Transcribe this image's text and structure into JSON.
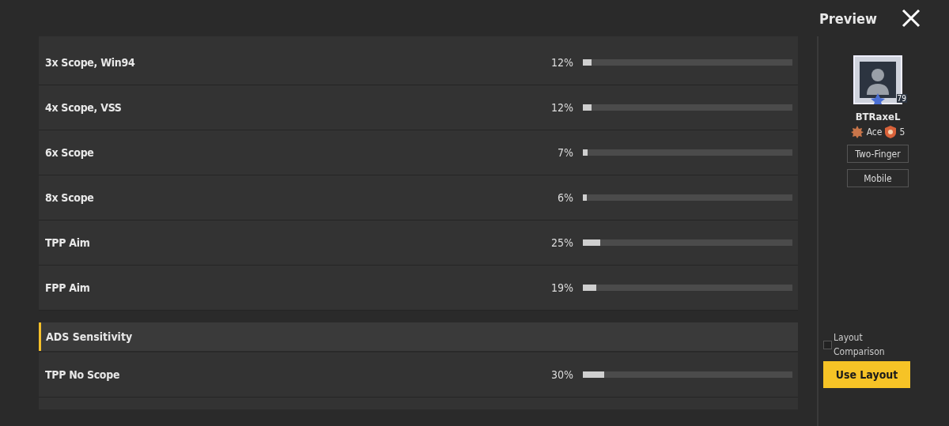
{
  "settings": [
    {
      "kind": "slider",
      "label": "3x Scope, Win94",
      "reading": "12%",
      "level": 0.04
    },
    {
      "kind": "slider",
      "label": "4x Scope, VSS",
      "reading": "12%",
      "level": 0.04
    },
    {
      "kind": "slider",
      "label": "6x Scope",
      "reading": "7%",
      "level": 0.023
    },
    {
      "kind": "slider",
      "label": "8x Scope",
      "reading": "6%",
      "level": 0.02
    },
    {
      "kind": "slider",
      "label": "TPP Aim",
      "reading": "25%",
      "level": 0.083
    },
    {
      "kind": "slider",
      "label": "FPP Aim",
      "reading": "19%",
      "level": 0.063
    },
    {
      "kind": "header",
      "label": "ADS Sensitivity"
    },
    {
      "kind": "slider",
      "label": "TPP No Scope",
      "reading": "30%",
      "level": 0.1
    }
  ],
  "preview": {
    "title": "Preview",
    "player": {
      "level_badge": "79",
      "name": "BTRaxeL",
      "tier": "Ace",
      "tier_level": "5"
    },
    "tags": [
      "Two-Finger",
      "Mobile"
    ],
    "layout_comparison": {
      "label": "Layout Comparison",
      "checked": false
    },
    "button": "Use Layout"
  }
}
